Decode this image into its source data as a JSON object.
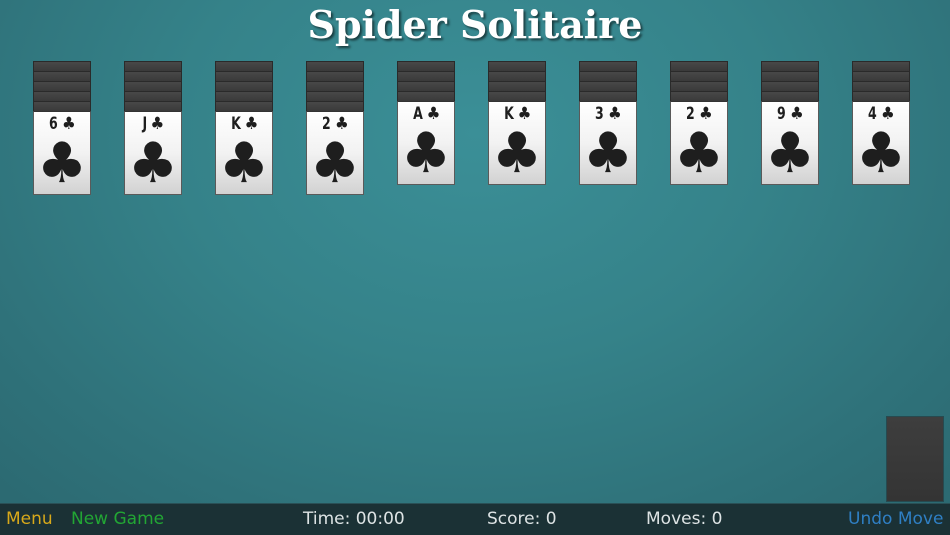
{
  "title": "Spider Solitaire",
  "colors": {
    "menu": "#d8a91a",
    "new_game": "#22a634",
    "undo": "#2f7fc4",
    "status_text": "#dde3e4"
  },
  "tableau": [
    {
      "face_down": 5,
      "rank": "6",
      "suit": "♣",
      "suit_name": "clubs"
    },
    {
      "face_down": 5,
      "rank": "J",
      "suit": "♣",
      "suit_name": "clubs"
    },
    {
      "face_down": 5,
      "rank": "K",
      "suit": "♣",
      "suit_name": "clubs"
    },
    {
      "face_down": 5,
      "rank": "2",
      "suit": "♣",
      "suit_name": "clubs"
    },
    {
      "face_down": 4,
      "rank": "A",
      "suit": "♣",
      "suit_name": "clubs"
    },
    {
      "face_down": 4,
      "rank": "K",
      "suit": "♣",
      "suit_name": "clubs"
    },
    {
      "face_down": 4,
      "rank": "3",
      "suit": "♣",
      "suit_name": "clubs"
    },
    {
      "face_down": 4,
      "rank": "2",
      "suit": "♣",
      "suit_name": "clubs"
    },
    {
      "face_down": 4,
      "rank": "9",
      "suit": "♣",
      "suit_name": "clubs"
    },
    {
      "face_down": 4,
      "rank": "4",
      "suit": "♣",
      "suit_name": "clubs"
    }
  ],
  "stock": {
    "icon": "card-back"
  },
  "bottom_bar": {
    "menu": "Menu",
    "new_game": "New Game",
    "time": "Time: 00:00",
    "score": "Score: 0",
    "moves": "Moves: 0",
    "undo": "Undo Move"
  }
}
